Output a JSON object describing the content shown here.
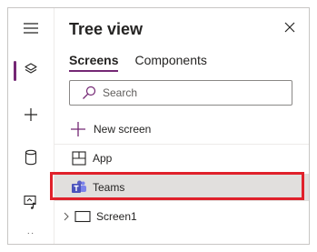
{
  "rail": {
    "items": [
      {
        "name": "hamburger-menu-icon"
      },
      {
        "name": "tree-view-layers-icon",
        "active": true
      },
      {
        "name": "insert-plus-icon"
      },
      {
        "name": "data-cylinder-icon"
      },
      {
        "name": "media-icon"
      }
    ],
    "more": "··"
  },
  "panel": {
    "title": "Tree view",
    "close_icon": "close-icon",
    "tabs": [
      {
        "label": "Screens",
        "active": true
      },
      {
        "label": "Components",
        "active": false
      }
    ],
    "search": {
      "placeholder": "Search",
      "value": ""
    },
    "new_screen_label": "New screen",
    "tree": [
      {
        "label": "App",
        "icon": "app-grid-icon",
        "selected": false
      },
      {
        "label": "Teams",
        "icon": "teams-icon",
        "selected": true,
        "highlighted": true
      },
      {
        "label": "Screen1",
        "icon": "screen-icon",
        "selected": false,
        "expandable": true
      }
    ]
  },
  "colors": {
    "accent": "#742774",
    "highlight_border": "#e0212b",
    "selected_row": "#e1dfdd",
    "teams_purple": "#5b5fc7"
  }
}
